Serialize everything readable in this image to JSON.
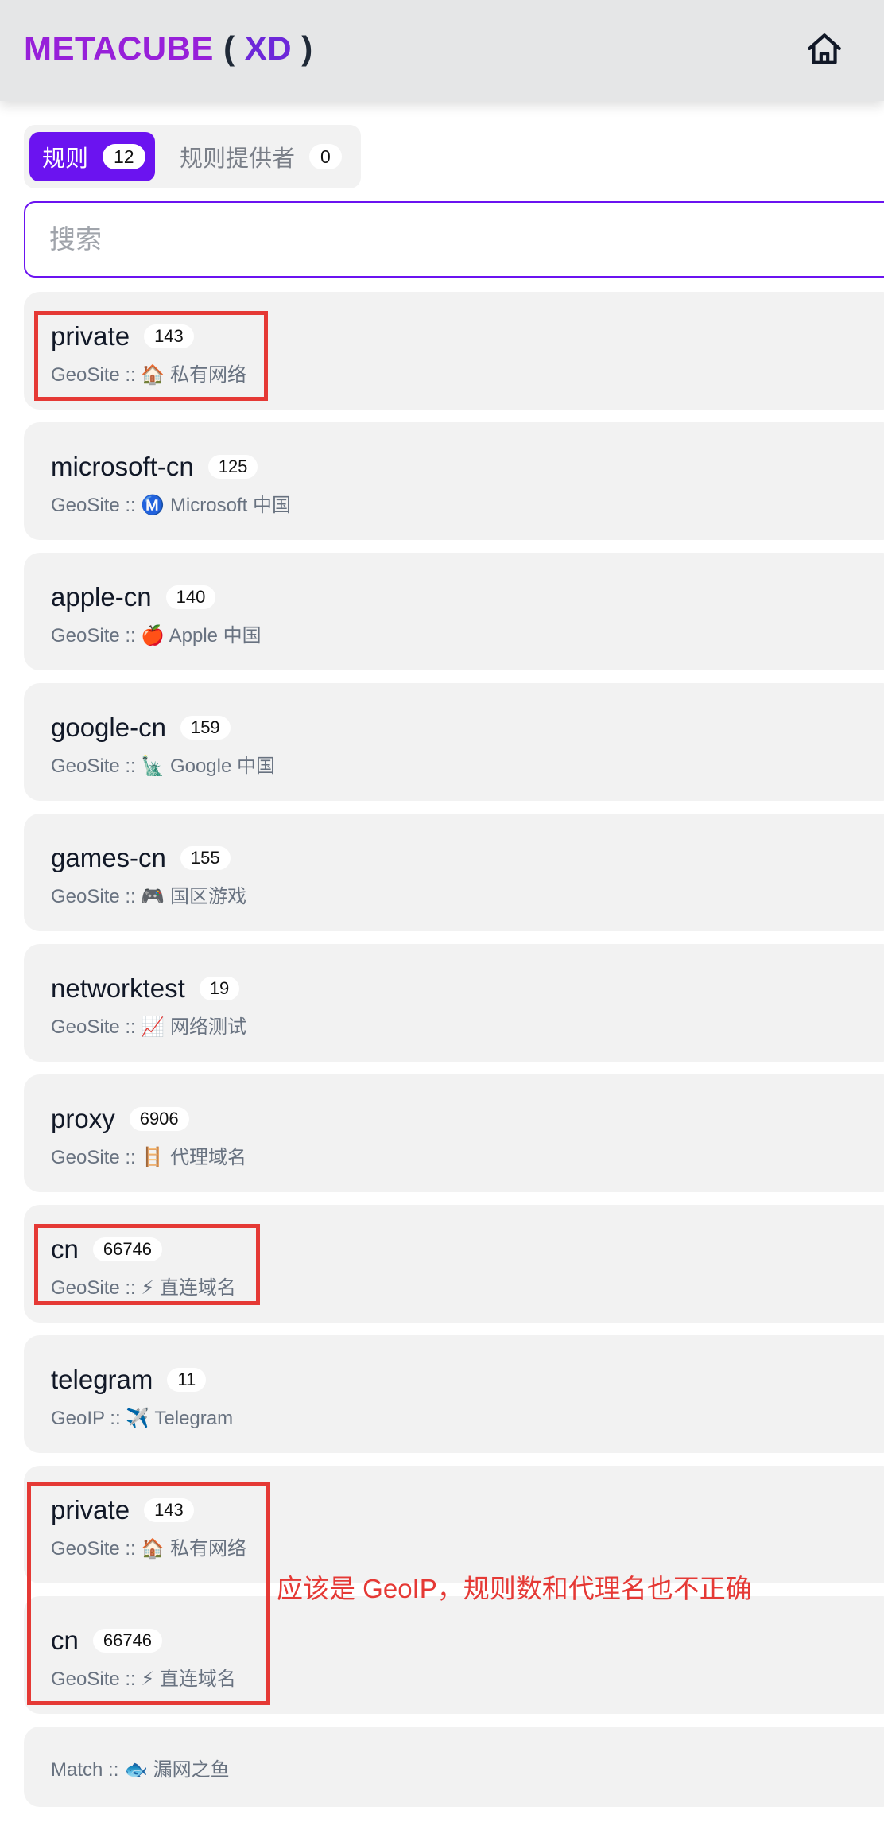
{
  "header": {
    "logo_main": "METACUBE",
    "logo_open": "(",
    "logo_xd": "XD",
    "logo_close": ")",
    "home_icon": "home-icon"
  },
  "tabs": [
    {
      "label": "规则",
      "count": "12",
      "active": true
    },
    {
      "label": "规则提供者",
      "count": "0",
      "active": false
    }
  ],
  "search": {
    "placeholder": "搜索"
  },
  "rules": [
    {
      "name": "private",
      "count": "143",
      "detail": "GeoSite :: 🏠 私有网络"
    },
    {
      "name": "microsoft-cn",
      "count": "125",
      "detail": "GeoSite :: Ⓜ️ Microsoft 中国"
    },
    {
      "name": "apple-cn",
      "count": "140",
      "detail": "GeoSite :: 🍎 Apple 中国"
    },
    {
      "name": "google-cn",
      "count": "159",
      "detail": "GeoSite :: 🗽 Google 中国"
    },
    {
      "name": "games-cn",
      "count": "155",
      "detail": "GeoSite :: 🎮 国区游戏"
    },
    {
      "name": "networktest",
      "count": "19",
      "detail": "GeoSite :: 📈 网络测试"
    },
    {
      "name": "proxy",
      "count": "6906",
      "detail": "GeoSite :: 🪜 代理域名"
    },
    {
      "name": "cn",
      "count": "66746",
      "detail": "GeoSite :: ⚡ 直连域名"
    },
    {
      "name": "telegram",
      "count": "11",
      "detail": "GeoIP :: ✈️ Telegram"
    },
    {
      "name": "private",
      "count": "143",
      "detail": "GeoSite :: 🏠 私有网络"
    },
    {
      "name": "cn",
      "count": "66746",
      "detail": "GeoSite :: ⚡ 直连域名"
    }
  ],
  "match_rule": {
    "detail": "Match :: 🐟 漏网之鱼"
  },
  "annotation": {
    "note": "应该是 GeoIP，规则数和代理名也不正确",
    "color": "#e53935"
  },
  "colors": {
    "accent": "#6b13f0",
    "logo_purple": "#9720d9",
    "card_bg": "#f2f2f2"
  }
}
